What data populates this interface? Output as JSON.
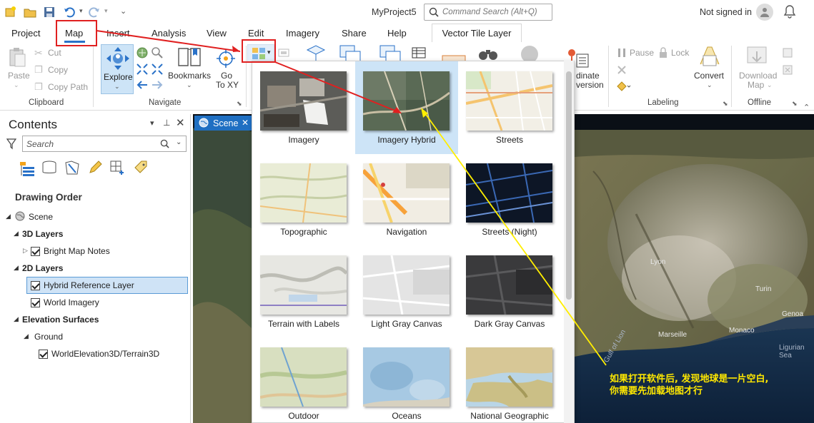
{
  "title_bar": {
    "project_name": "MyProject5",
    "command_search_placeholder": "Command Search (Alt+Q)",
    "signin_text": "Not signed in"
  },
  "tabs": [
    "Project",
    "Map",
    "Insert",
    "Analysis",
    "View",
    "Edit",
    "Imagery",
    "Share",
    "Help"
  ],
  "contextual_tab": "Vector Tile Layer",
  "ribbon": {
    "clipboard": {
      "paste": "Paste",
      "cut": "Cut",
      "copy": "Copy",
      "copy_path": "Copy Path",
      "label": "Clipboard"
    },
    "navigate": {
      "explore": "Explore",
      "bookmarks": "Bookmarks",
      "go_to_xy_1": "Go",
      "go_to_xy_2": "To XY",
      "label": "Navigate"
    },
    "partial_text_1": "dinate",
    "partial_text_2": "version",
    "labeling": {
      "pause": "Pause",
      "lock": "Lock",
      "convert": "Convert",
      "label": "Labeling"
    },
    "offline": {
      "download_1": "Download",
      "download_2": "Map",
      "label": "Offline"
    }
  },
  "contents": {
    "title": "Contents",
    "search_placeholder": "Search",
    "drawing_order": "Drawing Order",
    "tree": {
      "scene": "Scene",
      "layers_3d": "3D Layers",
      "bright_map_notes": "Bright Map Notes",
      "layers_2d": "2D Layers",
      "hybrid_reference": "Hybrid Reference Layer",
      "world_imagery": "World Imagery",
      "elevation_surfaces": "Elevation Surfaces",
      "ground": "Ground",
      "world_elevation": "WorldElevation3D/Terrain3D"
    }
  },
  "view_tab": {
    "label": "Scene"
  },
  "basemap_gallery": {
    "selected": "Imagery Hybrid",
    "items": [
      "Imagery",
      "Imagery Hybrid",
      "Streets",
      "Topographic",
      "Navigation",
      "Streets (Night)",
      "Terrain with Labels",
      "Light Gray Canvas",
      "Dark Gray Canvas",
      "Outdoor",
      "Oceans",
      "National Geographic"
    ]
  },
  "map_labels": {
    "lyon": "Lyon",
    "turin": "Turin",
    "genoa": "Genoa",
    "marseille": "Marseille",
    "monaco": "Monaco",
    "gulf_of_lion": "Gulf of Lion",
    "ligurian_sea": "Ligurian Sea"
  },
  "annotation": {
    "line1": "如果打开软件后, 发现地球是一片空白,",
    "line2": "你需要先加载地图才行"
  },
  "colors": {
    "accent": "#2a72c8",
    "annotation_box": "#e02020",
    "annotation_arrow_red": "#e02020",
    "annotation_arrow_yellow": "#ffee00",
    "annotation_text": "#ffe800"
  }
}
